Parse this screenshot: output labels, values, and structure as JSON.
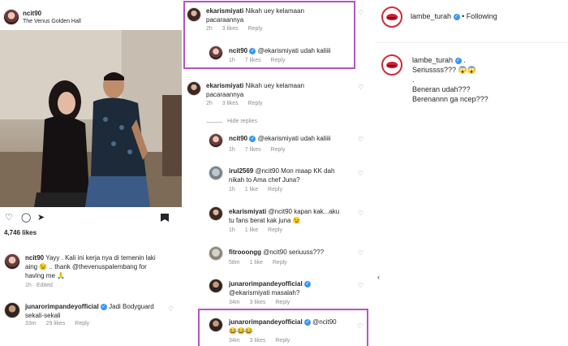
{
  "post": {
    "username": "ncit90",
    "location": "The Venus Golden Hall",
    "likes": "4,746 likes",
    "caption_user": "ncit90",
    "caption_text_1": "Yayy . Kali ini kerja nya di temenin laki",
    "caption_text_2": "aing 😉 .. thank @thevenuspalembang for",
    "caption_text_3": "having me 🙏",
    "caption_meta": "1h · Edited",
    "comment_user": "junarorimpandeyofficial",
    "comment_text_1": "Jadi Bodyguard",
    "comment_text_2": "sekali-sekali",
    "comment_time": "33m",
    "comment_likes": "29 likes",
    "comment_reply": "Reply"
  },
  "thread": {
    "top_user": "ekarismiyati",
    "top_text_1": "Nikah uey kelamaan",
    "top_text_2": "pacaraannya",
    "top_time": "2h",
    "top_likes": "3 likes",
    "top_reply": "Reply",
    "r1_user": "ncit90",
    "r1_text": "@ekarismiyati udah kaliiii",
    "r1_time": "1h",
    "r1_likes": "7 likes",
    "r1_reply": "Reply",
    "c2_user": "ekarismiyati",
    "c2_text_1": "Nikah uey kelamaan",
    "c2_text_2": "pacaraannya",
    "c2_time": "2h",
    "c2_likes": "3 likes",
    "c2_reply": "Reply",
    "hide_replies": "Hide replies",
    "c3_user": "ncit90",
    "c3_text": "@ekarismiyati udah kaliiii",
    "c3_time": "1h",
    "c3_likes": "7 likes",
    "c3_reply": "Reply",
    "c4_user": "irul2569",
    "c4_text_1": "@ncit90 Mon maap KK dah",
    "c4_text_2": "nikah to Ama chef Juna?",
    "c4_time": "1h",
    "c4_likes": "1 like",
    "c4_reply": "Reply",
    "c5_user": "ekarismiyati",
    "c5_text_1": "@ncit90 kapan kak...aku",
    "c5_text_2": "tu fans berat kak juna 😉",
    "c5_time": "1h",
    "c5_likes": "1 like",
    "c5_reply": "Reply",
    "c6_user": "fitrooongg",
    "c6_text": "@ncit90 seriuuss???",
    "c6_time": "58m",
    "c6_likes": "1 like",
    "c6_reply": "Reply",
    "c7_user": "junarorimpandeyofficial",
    "c7_text_1": "@ekarismiyati masalah?",
    "c7_time": "34m",
    "c7_likes": "3 likes",
    "c7_reply": "Reply",
    "c8_user": "junarorimpandeyofficial",
    "c8_text_1": "@ncit90",
    "c8_text_2": "😂😂😂",
    "c8_time": "34m",
    "c8_likes": "3 likes",
    "c8_reply": "Reply"
  },
  "lambe": {
    "header_user": "lambe_turah",
    "following": "Following",
    "post_user": "lambe_turah",
    "line_1": "Seriussss??? 😱😱",
    "line_2": ".",
    "line_3": "Beneran udah???",
    "line_4": "Berenannn ga ncep???"
  },
  "colors": {
    "highlight": "#b653c6",
    "verified": "#3897f0",
    "lips": "#d41f32"
  }
}
